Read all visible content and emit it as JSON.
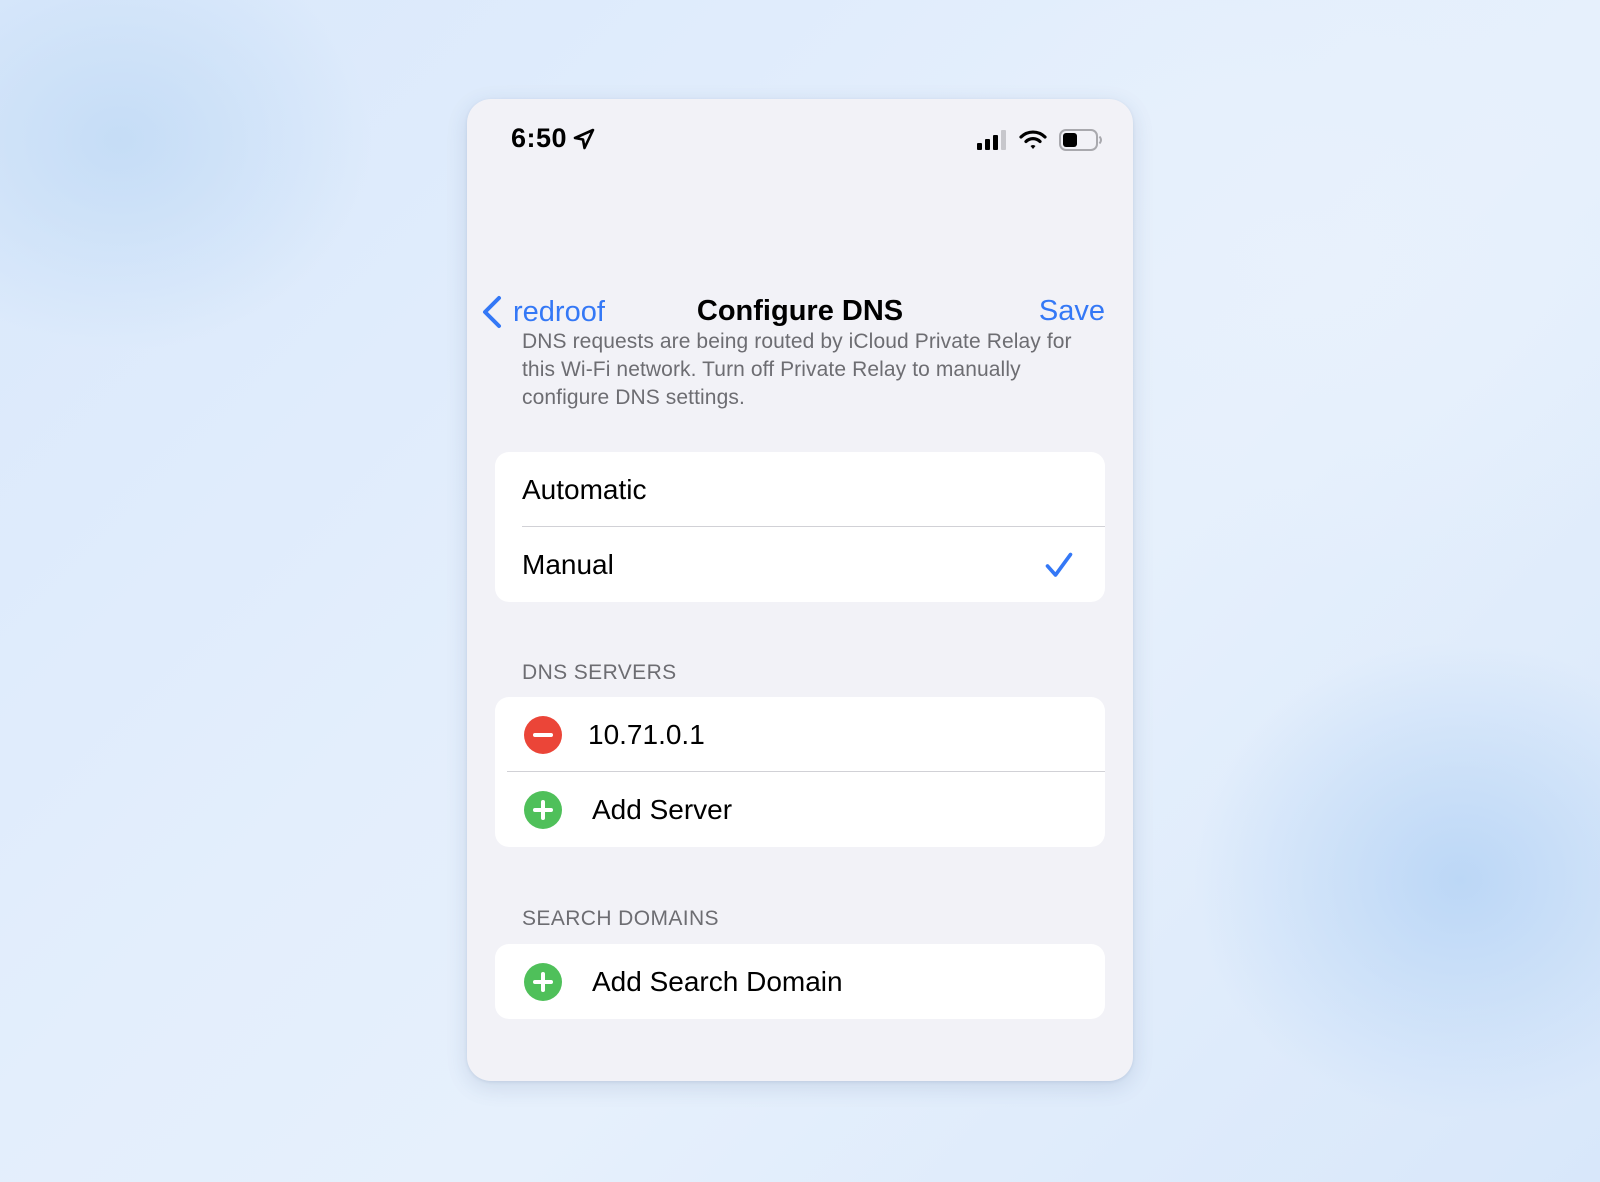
{
  "status_bar": {
    "time": "6:50",
    "location_icon": "location-arrow-icon",
    "signal_icon": "cellular-signal-icon",
    "wifi_icon": "wifi-icon",
    "battery_icon": "battery-icon"
  },
  "nav": {
    "back_icon": "chevron-left-icon",
    "back_label": "redroof",
    "title": "Configure DNS",
    "save_label": "Save"
  },
  "notice": "DNS requests are being routed by iCloud Private Relay for this Wi-Fi network. Turn off Private Relay to manually configure DNS settings.",
  "mode": {
    "options": [
      {
        "label": "Automatic",
        "selected": false
      },
      {
        "label": "Manual",
        "selected": true
      }
    ],
    "checkmark_icon": "checkmark-icon"
  },
  "dns_servers": {
    "header": "DNS SERVERS",
    "servers": [
      "10.71.0.1"
    ],
    "remove_icon": "remove-circle-icon",
    "add_icon": "add-circle-icon",
    "add_label": "Add Server"
  },
  "search_domains": {
    "header": "SEARCH DOMAINS",
    "add_icon": "add-circle-icon",
    "add_label": "Add Search Domain"
  },
  "colors": {
    "accent": "#3478f6",
    "remove": "#eb4538",
    "add": "#4fc05a",
    "background": "#f2f2f7"
  }
}
